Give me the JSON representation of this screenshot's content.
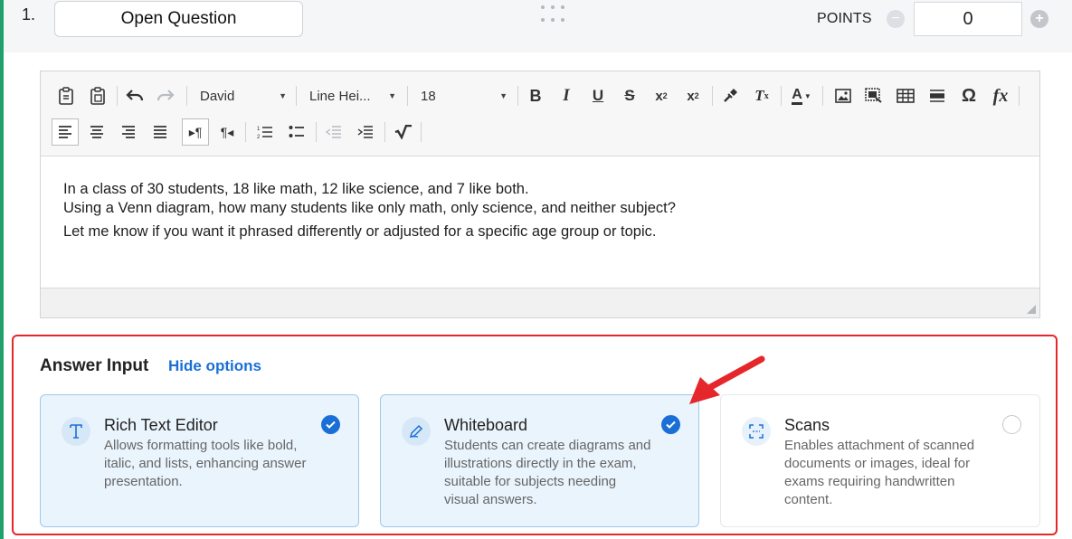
{
  "question": {
    "number": "1.",
    "type_label": "Open Question",
    "points_label": "POINTS",
    "points_value": "0"
  },
  "toolbar": {
    "font_family": "David",
    "line_height": "Line Hei...",
    "font_size": "18"
  },
  "editor": {
    "lines": [
      "In a class of 30 students, 18 like math, 12 like science, and 7 like both.",
      "Using a Venn diagram, how many students like only math, only science, and neither subject?",
      "Let me know if you want it phrased differently or adjusted for a specific age group or topic."
    ]
  },
  "answer_input": {
    "title": "Answer Input",
    "hide_label": "Hide options",
    "options": [
      {
        "title": "Rich Text Editor",
        "description": "Allows formatting tools like bold, italic, and lists, enhancing answer presentation.",
        "icon": "text-format-icon",
        "selected": true
      },
      {
        "title": "Whiteboard",
        "description": "Students can create diagrams and illustrations directly in the exam, suitable for subjects needing visual answers.",
        "icon": "pen-icon",
        "selected": true
      },
      {
        "title": "Scans",
        "description": "Enables attachment of scanned documents or images, ideal for exams requiring handwritten content.",
        "icon": "scan-icon",
        "selected": false
      }
    ]
  },
  "colors": {
    "accent": "#1a6fd6",
    "highlight_border": "#e5262b",
    "left_accent": "#22a06b"
  }
}
